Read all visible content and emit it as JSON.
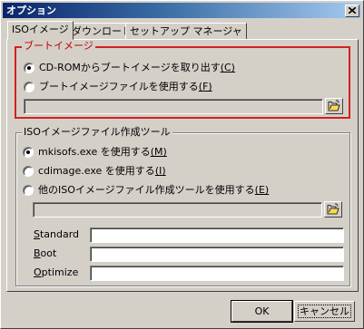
{
  "window": {
    "title": "オプション",
    "close_symbol": "×"
  },
  "tabs": [
    {
      "label": "ISOイメージ",
      "selected": true
    },
    {
      "label": "ダウンロード",
      "selected": false
    },
    {
      "label": "セットアップ マネージャ",
      "selected": false
    }
  ],
  "boot_group": {
    "legend": "ブートイメージ",
    "options": [
      {
        "label": "CD-ROMからブートイメージを取り出す",
        "key": "(C)",
        "selected": true
      },
      {
        "label": "ブートイメージファイルを使用する",
        "key": "(F)",
        "selected": false
      }
    ],
    "path_value": ""
  },
  "tool_group": {
    "legend": "ISOイメージファイル作成ツール",
    "options": [
      {
        "label": "mkisofs.exe を使用する",
        "key": "(M)",
        "selected": true
      },
      {
        "label": "cdimage.exe を使用する",
        "key": "(I)",
        "selected": false
      },
      {
        "label": "他のISOイメージファイル作成ツールを使用する",
        "key": "(E)",
        "selected": false
      }
    ],
    "path_value": "",
    "fields": [
      {
        "label_first": "S",
        "label_rest": "tandard",
        "value": ""
      },
      {
        "label_first": "B",
        "label_rest": "oot",
        "value": ""
      },
      {
        "label_first": "O",
        "label_rest": "ptimize",
        "value": ""
      }
    ]
  },
  "footer": {
    "ok_label": "OK",
    "cancel_label": "キャンセル"
  },
  "colors": {
    "title_start": "#0a246a",
    "title_end": "#a6caf0",
    "highlight_border": "#d42020",
    "face": "#d4d0c8"
  },
  "icons": {
    "close": "close-icon",
    "browse": "open-folder-icon"
  }
}
